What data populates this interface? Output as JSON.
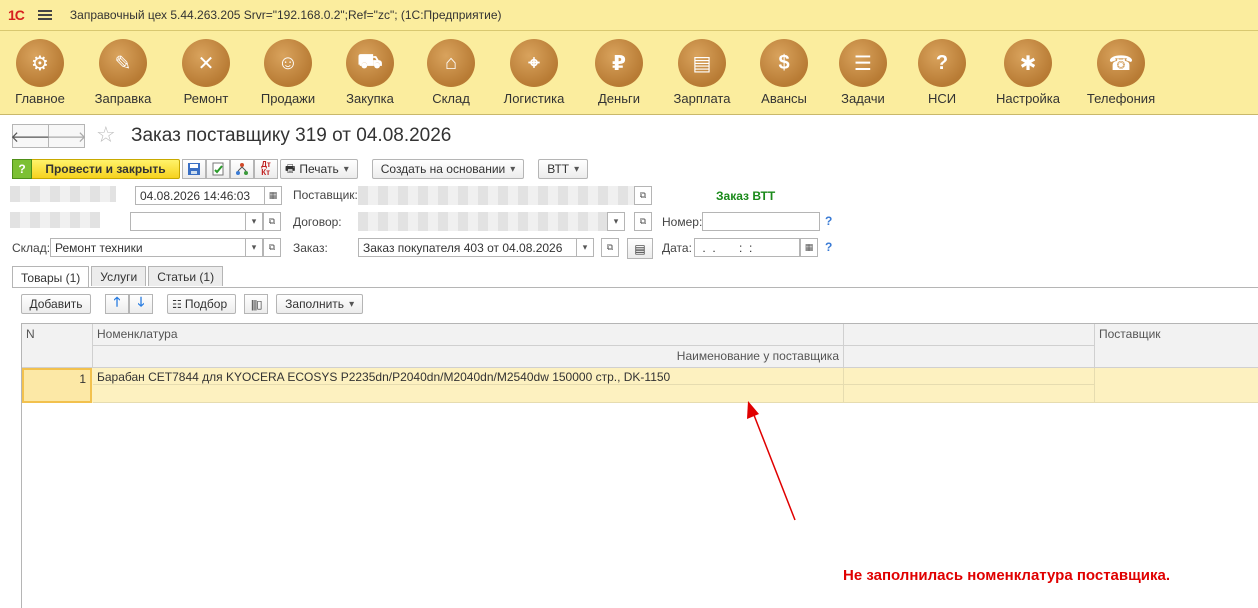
{
  "window": {
    "logo": "1С",
    "title": "Заправочный цех 5.44.263.205 Srvr=\"192.168.0.2\";Ref=\"zc\";  (1С:Предприятие)"
  },
  "sections": [
    {
      "label": "Главное",
      "icon": "gears-icon",
      "glyph": "⚙"
    },
    {
      "label": "Заправка",
      "icon": "refill-icon",
      "glyph": "✎"
    },
    {
      "label": "Ремонт",
      "icon": "tools-icon",
      "glyph": "✕"
    },
    {
      "label": "Продажи",
      "icon": "sale-icon",
      "glyph": "☺"
    },
    {
      "label": "Закупка",
      "icon": "cart-icon",
      "glyph": "⛟"
    },
    {
      "label": "Склад",
      "icon": "warehouse-icon",
      "glyph": "⌂"
    },
    {
      "label": "Логистика",
      "icon": "map-icon",
      "glyph": "⌖"
    },
    {
      "label": "Деньги",
      "icon": "money-bag-icon",
      "glyph": "₽"
    },
    {
      "label": "Зарплата",
      "icon": "wallet-icon",
      "glyph": "▤"
    },
    {
      "label": "Авансы",
      "icon": "advance-icon",
      "glyph": "$"
    },
    {
      "label": "Задачи",
      "icon": "tasks-icon",
      "glyph": "☰"
    },
    {
      "label": "НСИ",
      "icon": "book-icon",
      "glyph": "?"
    },
    {
      "label": "Настройка",
      "icon": "settings-icon",
      "glyph": "✱"
    },
    {
      "label": "Телефония",
      "icon": "phone-icon",
      "glyph": "☎"
    }
  ],
  "form": {
    "title": "Заказ поставщику 319 от 04.08.2026",
    "commands": {
      "post_close": "Провести и закрыть",
      "print": "Печать",
      "create_based": "Создать на основании",
      "vtt": "ВТТ"
    },
    "fields": {
      "date_value": "04.08.2026 14:46:03",
      "supplier_label": "Поставщик:",
      "contract_label": "Договор:",
      "warehouse_label": "Склад:",
      "warehouse_value": "Ремонт техники",
      "order_label": "Заказ:",
      "order_value": "Заказ покупателя 403 от 04.08.2026",
      "number_label": "Номер:",
      "number_value": "",
      "date_label": "Дата:",
      "date2_value": " .  .       :  :",
      "vtt_order_text": "Заказ ВТТ",
      "help_mark": "?"
    },
    "tabs": [
      {
        "label": "Товары (1)",
        "active": true
      },
      {
        "label": "Услуги",
        "active": false
      },
      {
        "label": "Статьи (1)",
        "active": false
      }
    ],
    "table_commands": {
      "add": "Добавить",
      "selection": "Подбор",
      "fill": "Заполнить"
    },
    "table": {
      "columns": {
        "n": "N",
        "nomenclature": "Номенклатура",
        "supplier_name": "Наименование у поставщика",
        "supplier": "Поставщик"
      },
      "rows": [
        {
          "n": "1",
          "nomenclature": "Барабан CET7844 для KYOCERA ECOSYS P2235dn/P2040dn/M2040dn/M2540dw 150000 стр., DK-1150",
          "supplier_name": "",
          "supplier": ""
        }
      ]
    }
  },
  "annotation": {
    "text": "Не заполнилась номенклатура поставщика.",
    "color": "#e00000"
  }
}
